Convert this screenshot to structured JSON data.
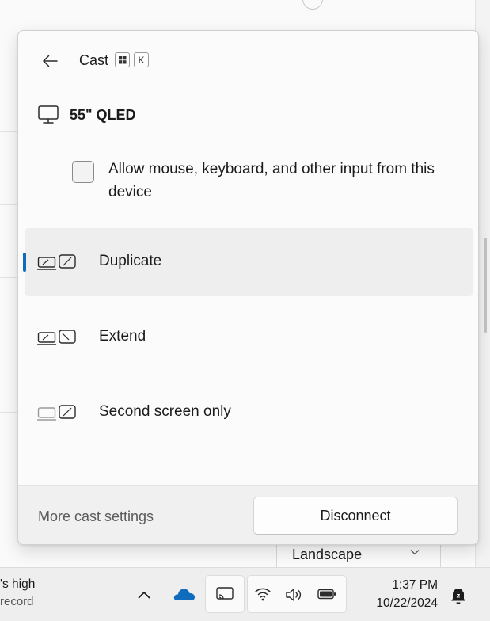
{
  "flyout": {
    "title": "Cast",
    "shortcut_key": "K",
    "device_name": "55\" QLED",
    "allow_input_label": "Allow mouse, keyboard, and other input from this device",
    "allow_input_checked": false,
    "accent_color": "#0f6cbd",
    "modes": [
      {
        "label": "Duplicate",
        "selected": true,
        "icon": "duplicate-display-icon"
      },
      {
        "label": "Extend",
        "selected": false,
        "icon": "extend-display-icon"
      },
      {
        "label": "Second screen only",
        "selected": false,
        "icon": "second-screen-only-icon"
      }
    ],
    "footer": {
      "more_settings_label": "More cast settings",
      "disconnect_label": "Disconnect"
    }
  },
  "background": {
    "select_value": "Landscape"
  },
  "taskbar": {
    "news_line1": "'s high",
    "news_line2": "record",
    "time": "1:37 PM",
    "date": "10/22/2024",
    "icons": [
      "chevron-up-icon",
      "onedrive-cloud-icon",
      "cast-icon",
      "wifi-icon",
      "volume-icon",
      "battery-icon",
      "do-not-disturb-icon"
    ]
  }
}
